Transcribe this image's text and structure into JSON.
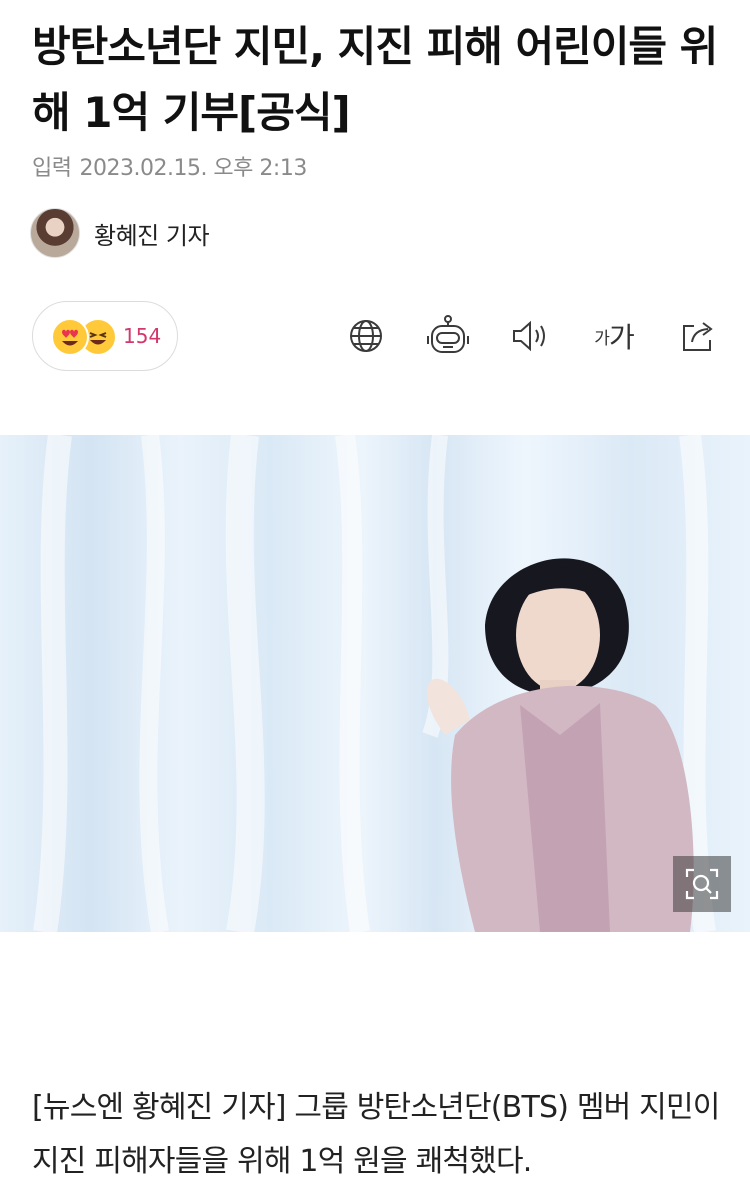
{
  "article": {
    "headline": "방탄소년단 지민, 지진 피해 어린이들 위해 1억 기부[공식]",
    "date_label": "입력",
    "date_value": "2023.02.15. 오후 2:13",
    "author_name": "황혜진 기자",
    "body_text": "[뉴스엔 황혜진 기자] 그룹 방탄소년단(BTS) 멤버 지민이 지진 피해자들을 위해 1억 원을 쾌척했다."
  },
  "reactions": {
    "count": "154",
    "emojis": [
      "heart-eyes-emoji",
      "laughing-emoji"
    ]
  },
  "toolbar": {
    "icons": [
      "globe-icon",
      "robot-icon",
      "speaker-icon",
      "font-size-icon",
      "share-icon"
    ],
    "font_size_small": "가",
    "font_size_large": "가"
  },
  "photo": {
    "zoom_icon": "zoom-icon"
  },
  "colors": {
    "reaction_count": "#d2386c",
    "headline": "#111111",
    "meta": "#8a8a8a"
  }
}
